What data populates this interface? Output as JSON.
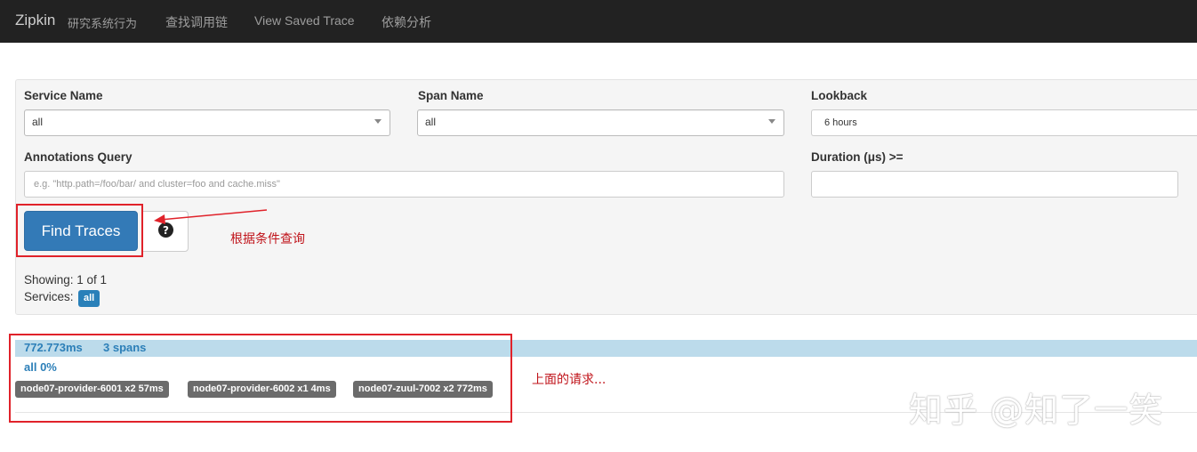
{
  "nav": {
    "brand": "Zipkin",
    "subtitle": "研究系统行为",
    "links": [
      "查找调用链",
      "View Saved Trace",
      "依赖分析"
    ]
  },
  "search": {
    "service_label": "Service Name",
    "service_value": "all",
    "span_label": "Span Name",
    "span_value": "all",
    "lookback_label": "Lookback",
    "lookback_value": "6 hours",
    "annotations_label": "Annotations Query",
    "annotations_placeholder": "e.g. \"http.path=/foo/bar/ and cluster=foo and cache.miss\"",
    "duration_label": "Duration (μs) >=",
    "duration_value": "",
    "find_button": "Find Traces",
    "help_icon": "question-circle-icon"
  },
  "results": {
    "showing": "Showing: 1 of 1",
    "services_label": "Services:",
    "services_badge": "all"
  },
  "trace": {
    "duration": "772.773ms",
    "spans": "3 spans",
    "percent": "all 0%",
    "tags": [
      "node07-provider-6001 x2 57ms",
      "node07-provider-6002 x1 4ms",
      "node07-zuul-7002 x2 772ms"
    ]
  },
  "annotations": {
    "query_note": "根据条件查询",
    "request_note": "上面的请求..."
  },
  "watermark": "知乎 @知了一笑",
  "colors": {
    "navbar": "#222222",
    "primary": "#337ab7",
    "annotation_red": "#e0222a",
    "trace_bar": "#bcdbeb",
    "tag_bg": "#6b6b6b"
  }
}
